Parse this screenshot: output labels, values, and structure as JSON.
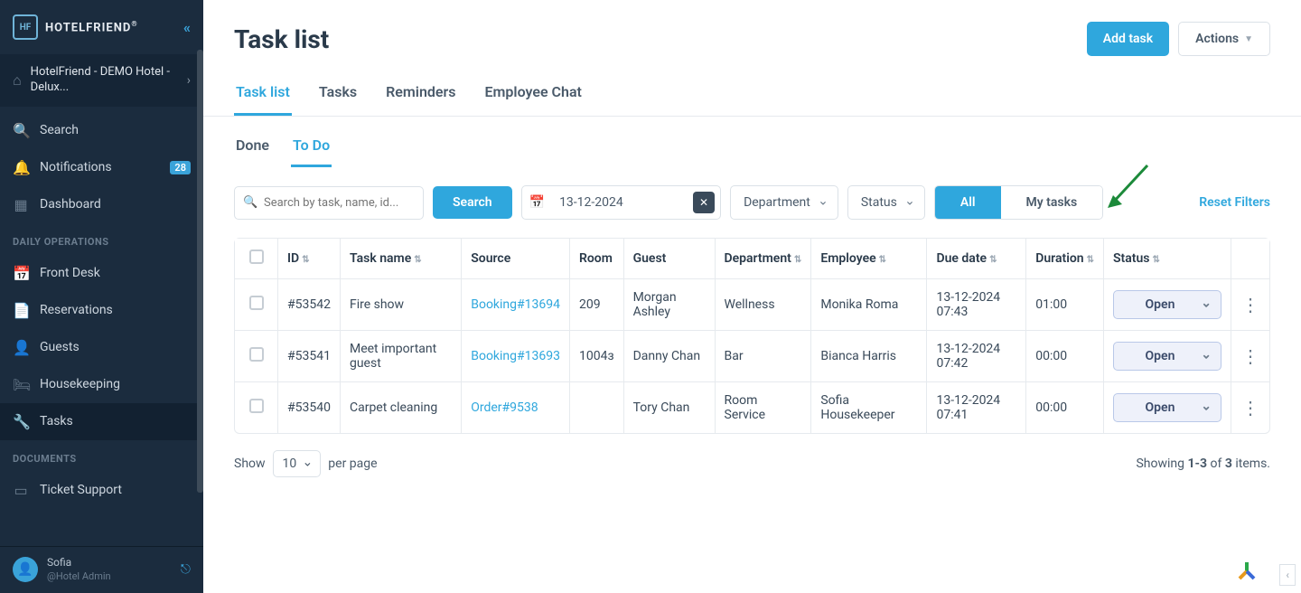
{
  "brand": {
    "name": "HOTELFRIEND",
    "badge": "HF"
  },
  "hotel_selector": "HotelFriend - DEMO Hotel - Delux...",
  "nav": {
    "top": [
      {
        "label": "Search",
        "icon": "🔍"
      },
      {
        "label": "Notifications",
        "icon": "🔔",
        "badge": "28"
      },
      {
        "label": "Dashboard",
        "icon": "▦"
      }
    ],
    "daily_ops_header": "DAILY OPERATIONS",
    "daily_ops": [
      {
        "label": "Front Desk",
        "icon": "📅"
      },
      {
        "label": "Reservations",
        "icon": "📄"
      },
      {
        "label": "Guests",
        "icon": "👤"
      },
      {
        "label": "Housekeeping",
        "icon": "🛏"
      },
      {
        "label": "Tasks",
        "icon": "🔧",
        "active": true
      }
    ],
    "documents_header": "DOCUMENTS",
    "documents": [
      {
        "label": "Ticket Support",
        "icon": "▭"
      }
    ]
  },
  "user": {
    "name": "Sofia",
    "role": "@Hotel Admin"
  },
  "page": {
    "title": "Task list"
  },
  "header_buttons": {
    "add": "Add task",
    "actions": "Actions"
  },
  "tabs": [
    "Task list",
    "Tasks",
    "Reminders",
    "Employee Chat"
  ],
  "active_tab": 0,
  "subtabs": [
    "Done",
    "To Do"
  ],
  "active_subtab": 1,
  "filters": {
    "search_placeholder": "Search by task, name, id...",
    "search_btn": "Search",
    "date": "13-12-2024",
    "department": "Department",
    "status": "Status",
    "seg_all": "All",
    "seg_mine": "My tasks",
    "reset": "Reset Filters"
  },
  "columns": [
    "",
    "ID",
    "Task name",
    "Source",
    "Room",
    "Guest",
    "Department",
    "Employee",
    "Due date",
    "Duration",
    "Status",
    ""
  ],
  "rows": [
    {
      "id": "#53542",
      "task": "Fire show",
      "source": "Booking#13694",
      "room": "209",
      "guest": "Morgan Ashley",
      "dept": "Wellness",
      "emp": "Monika Roma",
      "due": "13-12-2024 07:43",
      "dur": "01:00",
      "status": "Open"
    },
    {
      "id": "#53541",
      "task": "Meet important guest",
      "source": "Booking#13693",
      "room": "1004з",
      "guest": "Danny Chan",
      "dept": "Bar",
      "emp": "Bianca Harris",
      "due": "13-12-2024 07:42",
      "dur": "00:00",
      "status": "Open"
    },
    {
      "id": "#53540",
      "task": "Carpet cleaning",
      "source": "Order#9538",
      "room": "",
      "guest": "Tory Chan",
      "dept": "Room Service",
      "emp": "Sofia Housekeeper",
      "due": "13-12-2024 07:41",
      "dur": "00:00",
      "status": "Open"
    }
  ],
  "pager": {
    "show": "Show",
    "size": "10",
    "per": "per page",
    "summary_pre": "Showing ",
    "summary_range": "1-3",
    "summary_mid": " of ",
    "summary_total": "3",
    "summary_post": " items."
  }
}
